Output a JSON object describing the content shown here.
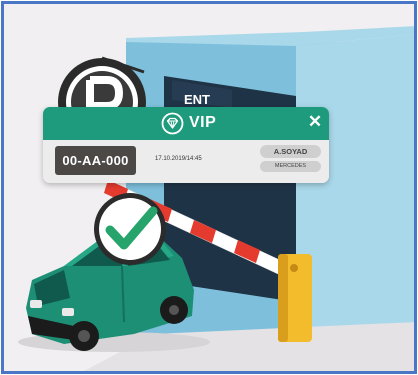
{
  "scene": {
    "sign_text": "ENT"
  },
  "vip_card": {
    "title": "VIP",
    "close_symbol": "✕",
    "plate": "00-AA-000",
    "timestamp": "17.10.2019/14:45",
    "owner_name": "A.SOYAD",
    "car_brand": "MERCEDES",
    "icons": {
      "emblem": "diamond-badge-icon",
      "close": "close-icon",
      "check": "check-icon",
      "parking": "parking-icon"
    }
  },
  "colors": {
    "frame_border": "#4a76c6",
    "vip_green": "#1e9b7c",
    "car_green": "#1d8f75",
    "check_green": "#27a46b",
    "barrier_red": "#e53b2f",
    "barrier_post": "#f3bc2d",
    "wall_blue": "#7ec0dc",
    "plate_dark": "#4c4846"
  }
}
